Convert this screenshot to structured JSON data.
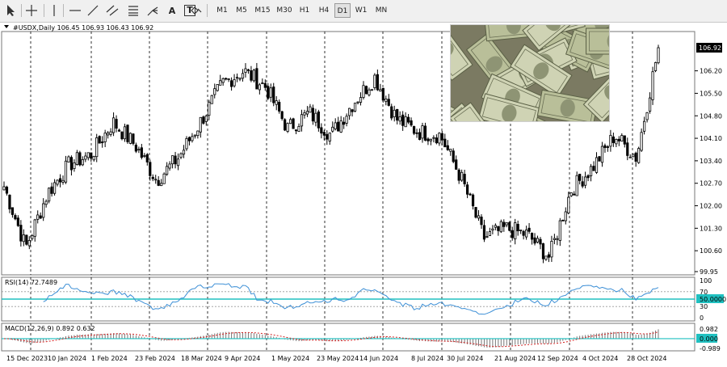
{
  "toolbar": {
    "tools": [
      {
        "icon": "cursor-arrow-icon"
      },
      {
        "icon": "crosshair-icon"
      },
      {
        "icon": "vertical-line-icon"
      },
      {
        "icon": "horizontal-line-icon"
      },
      {
        "icon": "trendline-icon"
      },
      {
        "icon": "equidistant-channel-icon"
      },
      {
        "icon": "fibonacci-icon"
      },
      {
        "icon": "andrews-pitchfork-icon"
      },
      {
        "icon": "text-label",
        "label": "A"
      },
      {
        "icon": "text-box-icon",
        "label": "T"
      },
      {
        "icon": "arrow-shapes-icon"
      }
    ],
    "timeframes": [
      "M1",
      "M5",
      "M15",
      "M30",
      "H1",
      "H4",
      "D1",
      "W1",
      "MN"
    ],
    "active_timeframe": "D1"
  },
  "main_panel": {
    "header": "#USDX,Daily  106.45 106.93 106.43 106.92",
    "current_price": "106.92",
    "price_labels": [
      "106.20",
      "105.50",
      "104.80",
      "104.10",
      "103.40",
      "102.70",
      "102.00",
      "101.30",
      "100.60",
      "99.95"
    ]
  },
  "rsi_panel": {
    "header": "RSI(14) 72.7489",
    "level_labels": [
      "100",
      "70",
      "50.0000",
      "30",
      "0"
    ],
    "line_color": "#3c8fd6"
  },
  "macd_panel": {
    "header": "MACD(12,26,9) 0.892 0.632",
    "labels": [
      "0.982",
      "0.000",
      "-0.989"
    ],
    "signal_color": "#d22020"
  },
  "date_labels": [
    "15 Dec 2023",
    "10 Jan 2024",
    "1 Feb 2024",
    "23 Feb 2024",
    "18 Mar 2024",
    "9 Apr 2024",
    "1 May 2024",
    "23 May 2024",
    "14 Jun 2024",
    "8 Jul 2024",
    "30 Jul 2024",
    "21 Aug 2024",
    "12 Sep 2024",
    "4 Oct 2024",
    "28 Oct 2024"
  ],
  "colors": {
    "accent_cyan": "#20c0c0",
    "candle": "#000000",
    "background": "#ffffff"
  },
  "chart_data": {
    "type": "candlestick",
    "title": "#USDX,Daily",
    "ohlc_last": {
      "open": 106.45,
      "high": 106.93,
      "low": 106.43,
      "close": 106.92
    },
    "ylim": [
      99.95,
      106.92
    ],
    "anchors": [
      {
        "date": "15 Dec 2023",
        "close": 102.6
      },
      {
        "date": "28 Dec 2023",
        "close": 100.7
      },
      {
        "date": "10 Jan 2024",
        "close": 102.4
      },
      {
        "date": "18 Jan 2024",
        "close": 103.3
      },
      {
        "date": "1 Feb 2024",
        "close": 103.6
      },
      {
        "date": "9 Feb 2024",
        "close": 104.6
      },
      {
        "date": "23 Feb 2024",
        "close": 103.9
      },
      {
        "date": "8 Mar 2024",
        "close": 102.8
      },
      {
        "date": "18 Mar 2024",
        "close": 103.5
      },
      {
        "date": "1 Apr 2024",
        "close": 104.6
      },
      {
        "date": "9 Apr 2024",
        "close": 105.8
      },
      {
        "date": "16 Apr 2024",
        "close": 106.2
      },
      {
        "date": "1 May 2024",
        "close": 105.7
      },
      {
        "date": "15 May 2024",
        "close": 104.4
      },
      {
        "date": "23 May 2024",
        "close": 104.9
      },
      {
        "date": "5 Jun 2024",
        "close": 104.2
      },
      {
        "date": "14 Jun 2024",
        "close": 105.2
      },
      {
        "date": "26 Jun 2024",
        "close": 106.0
      },
      {
        "date": "8 Jul 2024",
        "close": 104.7
      },
      {
        "date": "18 Jul 2024",
        "close": 104.3
      },
      {
        "date": "30 Jul 2024",
        "close": 104.2
      },
      {
        "date": "5 Aug 2024",
        "close": 102.8
      },
      {
        "date": "21 Aug 2024",
        "close": 101.0
      },
      {
        "date": "28 Aug 2024",
        "close": 101.3
      },
      {
        "date": "12 Sep 2024",
        "close": 101.1
      },
      {
        "date": "27 Sep 2024",
        "close": 100.4
      },
      {
        "date": "4 Oct 2024",
        "close": 102.5
      },
      {
        "date": "15 Oct 2024",
        "close": 103.2
      },
      {
        "date": "28 Oct 2024",
        "close": 104.2
      },
      {
        "date": "5 Nov 2024",
        "close": 103.5
      },
      {
        "date": "14 Nov 2024",
        "close": 106.92
      }
    ],
    "rsi": {
      "last": 72.7489,
      "levels": [
        30,
        50,
        70
      ]
    },
    "macd": {
      "main": 0.892,
      "signal": 0.632,
      "ylim": [
        -0.989,
        0.982
      ]
    }
  }
}
